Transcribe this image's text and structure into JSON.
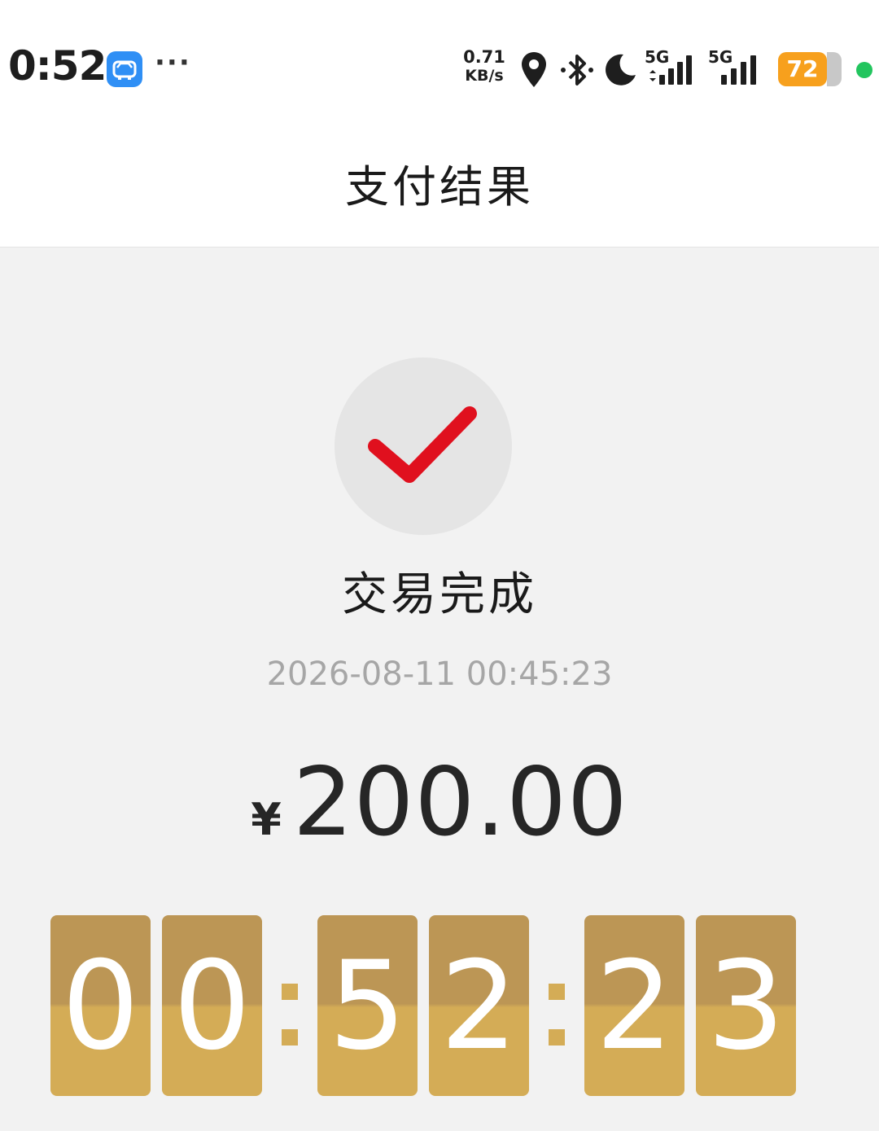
{
  "status_bar": {
    "time": "0:52",
    "more": "···",
    "net_speed_value": "0.71",
    "net_speed_unit": "KB/s",
    "sim1_label": "5G",
    "sim2_label": "5G",
    "battery": "72",
    "icons": [
      "app-icon",
      "location-icon",
      "bluetooth-icon",
      "moon-icon",
      "signal-icon",
      "signal-icon",
      "battery-icon",
      "dot-indicator"
    ]
  },
  "nav": {
    "title": "支付结果"
  },
  "result": {
    "status_text": "交易完成",
    "timestamp": "2026-08-11 00:45:23",
    "currency_symbol": "¥",
    "amount": "200.00",
    "icon": "check-icon"
  },
  "clock": {
    "digits": [
      "0",
      "0",
      "5",
      "2",
      "2",
      "3"
    ]
  },
  "colors": {
    "accent_check": "#e0101e",
    "clock_top": "#bc9655",
    "clock_bottom": "#d4ac56",
    "battery": "#f7a01d",
    "online_dot": "#22c55e"
  }
}
